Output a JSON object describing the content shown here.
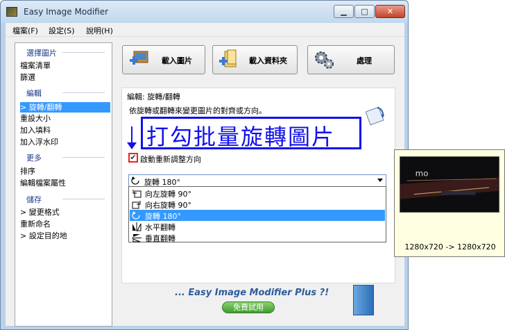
{
  "window": {
    "title": "Easy Image Modifier"
  },
  "menu": [
    "檔案(F)",
    "設定(S)",
    "說明(H)"
  ],
  "sidebar": {
    "sections": [
      {
        "title": "選擇圖片",
        "items": [
          "檔案清單",
          "篩選"
        ]
      },
      {
        "title": "編輯",
        "items": [
          "> 旋轉/翻轉",
          "重設大小",
          "加入填料",
          "加入浮水印"
        ]
      },
      {
        "title": "更多",
        "items": [
          "排序",
          "編輯檔案屬性"
        ]
      },
      {
        "title": "儲存",
        "items": [
          "> 變更格式",
          "重新命名",
          "> 設定目的地"
        ]
      }
    ],
    "active_item": "> 旋轉/翻轉"
  },
  "toolbar": {
    "load_images": "載入圖片",
    "load_folder": "載入資料夾",
    "process": "處理"
  },
  "panel": {
    "title": "編輯: 旋轉/翻轉",
    "description": "依旋轉或翻轉來變更圖片的對齊或方向。",
    "checkbox_label": "啟動重新調整方向",
    "checkbox_checked": true,
    "select_value": "旋轉 180°",
    "options": [
      "向左旋轉 90°",
      "向右旋轉 90°",
      "旋轉 180°",
      "水平翻轉",
      "垂直翻轉"
    ],
    "selected_option": "旋轉 180°"
  },
  "annotation": {
    "text": "打勾批量旋轉圖片",
    "color": "#1111ee"
  },
  "promo": {
    "text": "... Easy Image Modifier Plus ?!",
    "button": "免費試用"
  },
  "preview": {
    "caption": "1280x720 -> 1280x720"
  }
}
